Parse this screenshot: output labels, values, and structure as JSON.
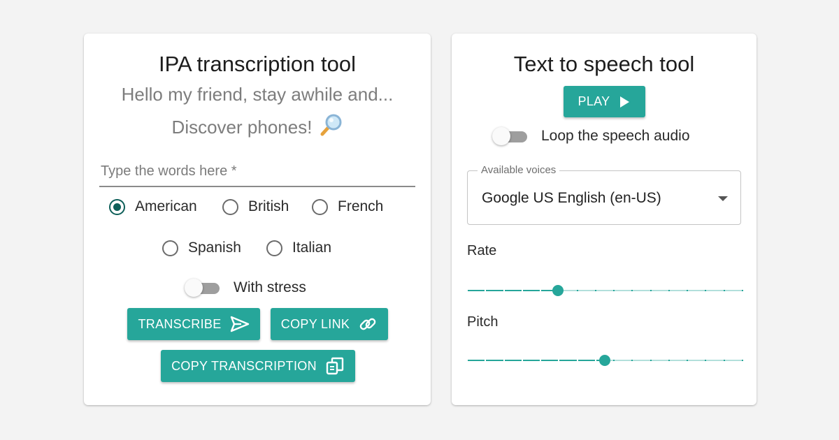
{
  "ipa_tool": {
    "title": "IPA transcription tool",
    "subtitle_line1": "Hello my friend, stay awhile and...",
    "subtitle_line2": "Discover phones!",
    "subtitle_icon": "magnifying-glass-icon",
    "input": {
      "placeholder": "Type the words here *",
      "value": ""
    },
    "dialects": [
      {
        "label": "American",
        "checked": true
      },
      {
        "label": "British",
        "checked": false
      },
      {
        "label": "French",
        "checked": false
      },
      {
        "label": "Spanish",
        "checked": false
      },
      {
        "label": "Italian",
        "checked": false
      }
    ],
    "stress_toggle": {
      "label": "With stress",
      "on": false
    },
    "buttons": {
      "transcribe": "TRANSCRIBE",
      "copy_link": "COPY LINK",
      "copy_transcription": "COPY TRANSCRIPTION"
    }
  },
  "tts_tool": {
    "title": "Text to speech tool",
    "play_button": "PLAY",
    "loop_toggle": {
      "label": "Loop the speech audio",
      "on": false
    },
    "voices": {
      "legend": "Available voices",
      "selected": "Google US English (en-US)"
    },
    "rate": {
      "label": "Rate",
      "fraction": 0.33,
      "steps": 15
    },
    "pitch": {
      "label": "Pitch",
      "fraction": 0.5,
      "steps": 15
    }
  },
  "colors": {
    "accent": "#26a69a",
    "accent_dark": "#0e5f59",
    "background": "#f3f3f3"
  }
}
